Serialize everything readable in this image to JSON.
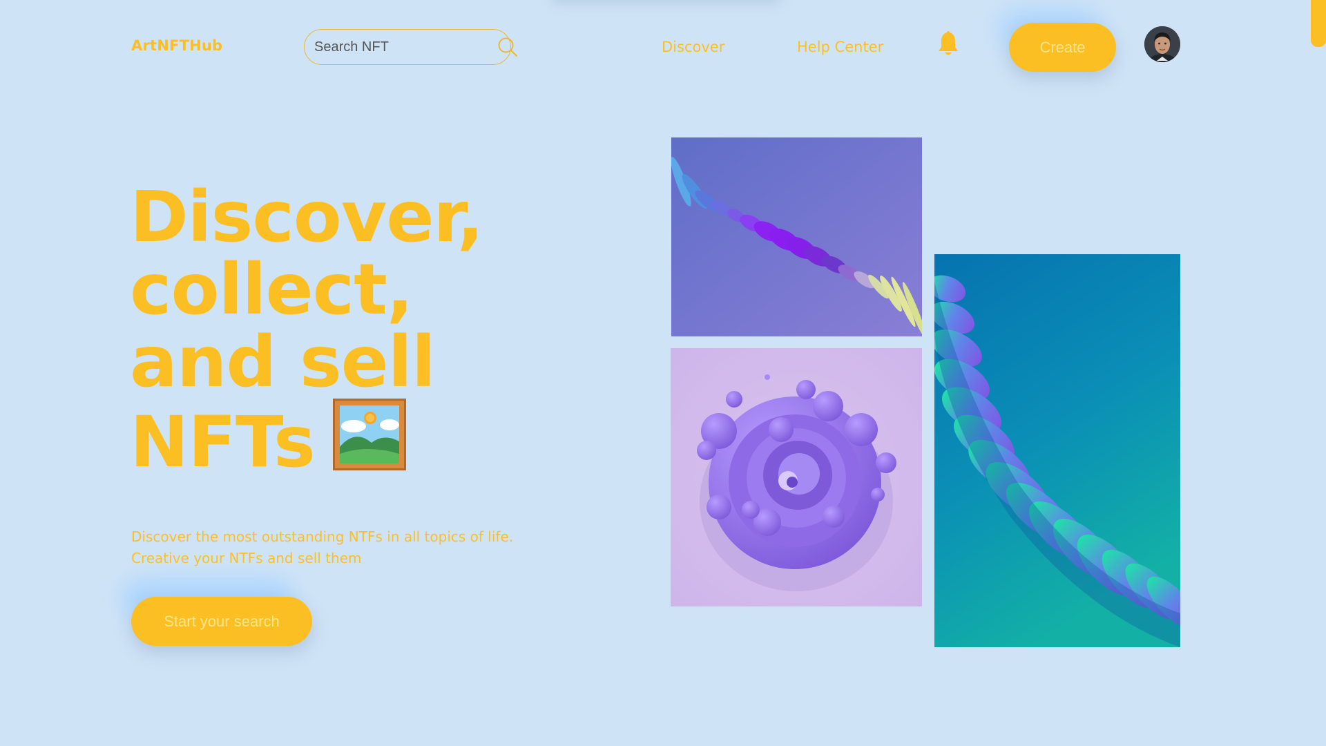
{
  "header": {
    "logo": "ArtNFTHub",
    "search": {
      "placeholder": "Search NFT",
      "value": ""
    },
    "nav": [
      {
        "label": "Discover"
      },
      {
        "label": "Help Center"
      }
    ],
    "create_label": "Create"
  },
  "hero": {
    "title_lines": [
      "Discover,",
      "collect,",
      "and sell",
      "NFTs"
    ],
    "title_emoji": "framed-picture",
    "subtitle_lines": [
      "Discover the most outstanding NTFs in all topics of life.",
      "Creative your NTFs and sell them"
    ],
    "cta_label": "Start your search"
  },
  "gallery": {
    "items": [
      {
        "name": "purple-ripple-art"
      },
      {
        "name": "violet-swirl-art"
      },
      {
        "name": "teal-wave-art"
      }
    ]
  },
  "colors": {
    "background": "#cfe3f6",
    "accent": "#fbbf24",
    "button_text": "#fde68a"
  },
  "icons": [
    "search-icon",
    "bell-icon",
    "framed-picture-icon"
  ]
}
